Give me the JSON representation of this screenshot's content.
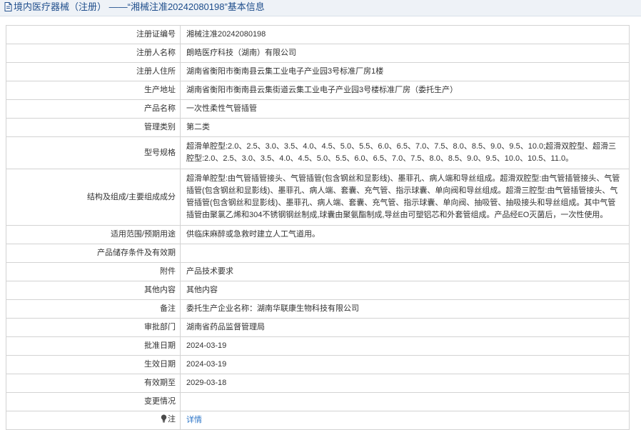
{
  "header": {
    "title": "境内医疗器械（注册） ——“湘械注准20242080198”基本信息"
  },
  "rows": [
    {
      "label": "注册证编号",
      "value": "湘械注准20242080198"
    },
    {
      "label": "注册人名称",
      "value": "朗皓医疗科技（湖南）有限公司"
    },
    {
      "label": "注册人住所",
      "value": "湖南省衡阳市衡南县云集工业电子产业园3号标准厂房1楼"
    },
    {
      "label": "生产地址",
      "value": "湖南省衡阳市衡南县云集街道云集工业电子产业园3号楼标准厂房（委托生产）"
    },
    {
      "label": "产品名称",
      "value": "一次性柔性气管插管"
    },
    {
      "label": "管理类别",
      "value": "第二类"
    },
    {
      "label": "型号规格",
      "value": "超滑单腔型:2.0、2.5、3.0、3.5、4.0、4.5、5.0、5.5、6.0、6.5、7.0、7.5、8.0、8.5、9.0、9.5、10.0;超滑双腔型、超滑三腔型:2.0、2.5、3.0、3.5、4.0、4.5、5.0、5.5、6.0、6.5、7.0、7.5、8.0、8.5、9.0、9.5、10.0、10.5、11.0。"
    },
    {
      "label": "结构及组成/主要组成成分",
      "value": "超滑单腔型:由气管插管接头、气管插管(包含钢丝和显影线)、墨菲孔、病人端和导丝组成。超滑双腔型:由气管插管接头、气管插管(包含钢丝和显影线)、墨菲孔、病人端、套囊、充气管、指示球囊、单向阀和导丝组成。超滑三腔型:由气管插管接头、气管插管(包含钢丝和显影线)、墨菲孔、病人端、套囊、充气管、指示球囊、单向阀、抽吸管、抽吸接头和导丝组成。其中气管插管由聚氯乙烯和304不锈钢钢丝制成,球囊由聚氨酯制成,导丝由可塑铝芯和外套管组成。产品经EO灭菌后，一次性使用。"
    },
    {
      "label": "适用范围/预期用途",
      "value": "供临床麻醉或急救时建立人工气道用。"
    },
    {
      "label": "产品储存条件及有效期",
      "value": ""
    },
    {
      "label": "附件",
      "value": "产品技术要求"
    },
    {
      "label": "其他内容",
      "value": "其他内容"
    },
    {
      "label": "备注",
      "value": "委托生产企业名称：湖南华联康生物科技有限公司"
    },
    {
      "label": "审批部门",
      "value": "湖南省药品监督管理局"
    },
    {
      "label": "批准日期",
      "value": "2024-03-19"
    },
    {
      "label": "生效日期",
      "value": "2024-03-19"
    },
    {
      "label": "有效期至",
      "value": "2029-03-18"
    },
    {
      "label": "变更情况",
      "value": ""
    },
    {
      "label": "注",
      "value": "详情"
    }
  ],
  "icons": {
    "title_icon": "document-icon",
    "note_icon": "lightbulb-icon"
  },
  "colors": {
    "title_text": "#1f4e8c",
    "link": "#2b74c7"
  }
}
